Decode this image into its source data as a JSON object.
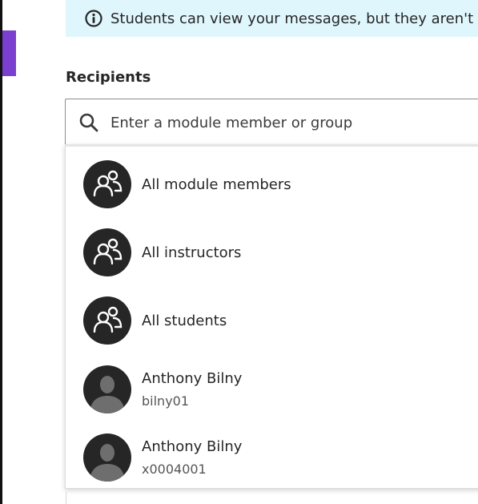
{
  "notice": {
    "text": "Students can view your messages, but they aren't",
    "icon": "info-icon"
  },
  "recipients": {
    "label": "Recipients",
    "search_placeholder": "Enter a module member or group",
    "search_value": ""
  },
  "options": [
    {
      "label": "All module members",
      "icon": "group-icon"
    },
    {
      "label": "All instructors",
      "icon": "group-icon"
    },
    {
      "label": "All students",
      "icon": "group-icon"
    },
    {
      "label": "Anthony Bilny",
      "sub": "bilny01",
      "icon": "user-avatar-icon"
    },
    {
      "label": "Anthony Bilny",
      "sub": "x0004001",
      "icon": "user-avatar-icon"
    }
  ],
  "colors": {
    "notice_bg": "#dff6fc",
    "accent_purple": "#7b3fcf",
    "avatar_bg": "#262626"
  }
}
